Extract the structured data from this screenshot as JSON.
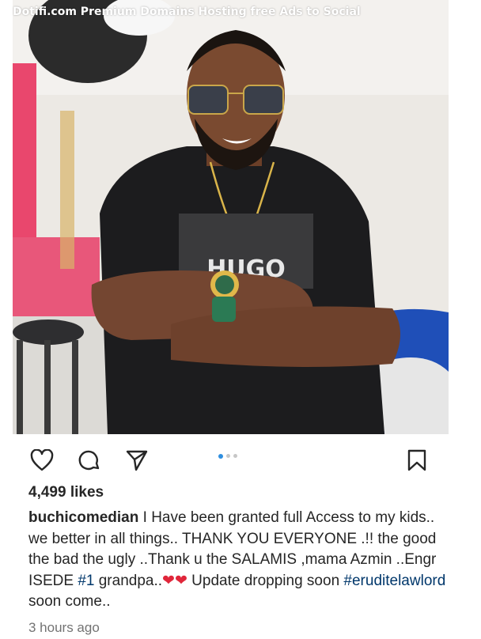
{
  "photo": {
    "watermark": "Dotifi.com Premium Domains Hosting free Ads to Social",
    "shirt_text": "HUGO"
  },
  "actions": {
    "like_icon": "heart-icon",
    "comment_icon": "comment-icon",
    "share_icon": "send-icon",
    "save_icon": "bookmark-icon"
  },
  "carousel": {
    "total": 3,
    "active": 1,
    "active_color": "#2f8fe0"
  },
  "post": {
    "likes": "4,499 likes",
    "username": "buchicomedian",
    "caption_1": " I Have been granted full Access to my kids.. we better in all things.. THANK YOU EVERYONE .!! the good the bad the ugly ..Thank u the SALAMIS ,mama Azmin ..Engr ISEDE ",
    "hashtag_1": "#1",
    "caption_2": " grandpa..",
    "emoji": "❤❤",
    "caption_3": " Update dropping soon ",
    "hashtag_2": "#eruditelawlord",
    "caption_4": " soon come..",
    "time": "3 hours ago"
  }
}
